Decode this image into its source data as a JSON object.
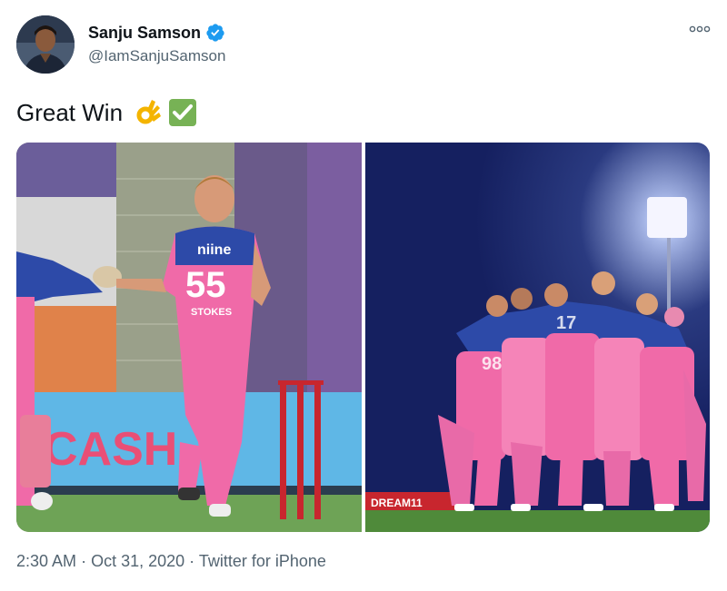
{
  "tweet": {
    "author_name": "Sanju Samson",
    "author_handle": "@IamSanjuSamson",
    "verified": true,
    "text": "Great Win",
    "emoji": [
      "ok-hand",
      "check-mark-button"
    ],
    "images": [
      {
        "icon": "stokes-handshake-photo",
        "jersey_number": "55",
        "jersey_name": "STOKES",
        "jersey_sponsor": "niine",
        "ad_text": "CASH"
      },
      {
        "icon": "team-huddle-photo",
        "ad_text": "DREAM11"
      }
    ],
    "time": "2:30 AM",
    "date": "Oct 31, 2020",
    "source": "Twitter for iPhone",
    "separator": "·",
    "more_icon": "ellipsis-icon",
    "colors": {
      "verified": "#1d9bf0",
      "muted": "#536471",
      "jersey_pink": "#f06aa8",
      "jersey_blue": "#2d4aa8"
    }
  }
}
